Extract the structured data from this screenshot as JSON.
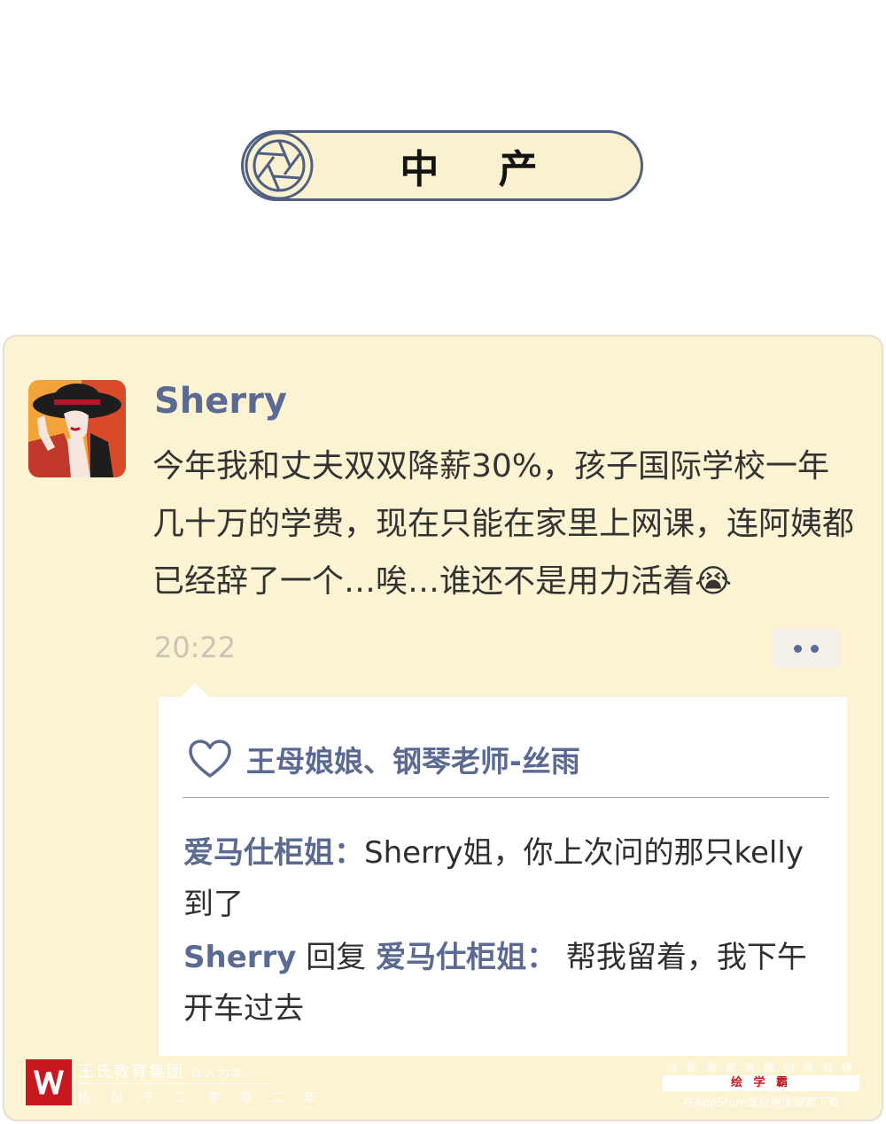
{
  "header": {
    "title": "中 产"
  },
  "post": {
    "username": "Sherry",
    "text": "今年我和丈夫双双降薪30%，孩子国际学校一年几十万的学费，现在只能在家里上网课，连阿姨都已经辞了一个…唉…谁还不是用力活着😭",
    "time": "20:22",
    "avatar_icon": "woman-with-hat-avatar",
    "more_icon": "more-dots-icon"
  },
  "likes": {
    "names": "王母娘娘、钢琴老师-丝雨",
    "icon": "heart-icon"
  },
  "comments": [
    {
      "author": "爱马仕柜姐：",
      "text": "Sherry姐，你上次问的那只kelly到了"
    },
    {
      "author": "Sherry",
      "reply_word": " 回复 ",
      "reply_to": "爱马仕柜姐：",
      "text": " 帮我留着，我下午开车过去"
    }
  ],
  "footer": {
    "org_name": "王氏教育集团",
    "org_tagline": "以人为本",
    "org_slogan": "始 创 于 二 零 零 二 年",
    "right_top": "让 画 画 更 有 趣 的 画 画 神 器",
    "right_app": "绘 学 霸",
    "right_bottom": "在AppStore或应用宝搜索下载"
  },
  "colors": {
    "accent": "#5a6a92",
    "card_bg": "#fbf3d2",
    "brand_red": "#c8171e"
  }
}
